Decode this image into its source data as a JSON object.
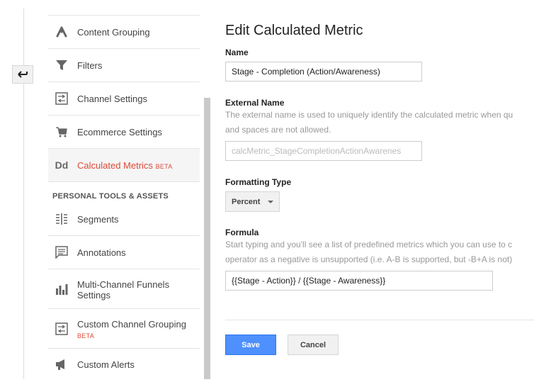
{
  "sidebar": {
    "items": [
      {
        "label": "Content Grouping",
        "icon": "content-grouping-icon"
      },
      {
        "label": "Filters",
        "icon": "filter-icon"
      },
      {
        "label": "Channel Settings",
        "icon": "channel-settings-icon"
      },
      {
        "label": "Ecommerce Settings",
        "icon": "cart-icon"
      },
      {
        "label": "Calculated Metrics",
        "badge": "BETA",
        "icon": "dd-icon",
        "active": true
      },
      {
        "label": "Segments",
        "icon": "segments-icon"
      },
      {
        "label": "Annotations",
        "icon": "annotations-icon"
      },
      {
        "label": "Multi-Channel Funnels Settings",
        "label_line1": "Multi-Channel Funnels",
        "label_line2": "Settings",
        "icon": "bar-chart-icon"
      },
      {
        "label": "Custom Channel Grouping",
        "badge": "BETA",
        "icon": "custom-channel-icon"
      },
      {
        "label": "Custom Alerts",
        "icon": "megaphone-icon"
      }
    ],
    "section_heading": "PERSONAL TOOLS & ASSETS",
    "icon_glyph_dd": "Dd"
  },
  "main": {
    "title": "Edit Calculated Metric",
    "name_label": "Name",
    "name_value": "Stage - Completion (Action/Awareness)",
    "external_label": "External Name",
    "external_help_1": "The external name is used to uniquely identify the calculated metric when qu",
    "external_help_2": "and spaces are not allowed.",
    "external_placeholder": "calcMetric_StageCompletionActionAwarenes",
    "formatting_label": "Formatting Type",
    "formatting_value": "Percent",
    "formula_label": "Formula",
    "formula_help_1": "Start typing and you'll see a list of predefined metrics which you can use to c",
    "formula_help_2": "operator as a negative is unsupported (i.e. A-B is supported, but -B+A is not)",
    "formula_value": "{{Stage - Action}} / {{Stage - Awareness}}",
    "save_label": "Save",
    "cancel_label": "Cancel"
  },
  "colors": {
    "accent": "#dd4b39",
    "primary_button": "#4d90fe"
  }
}
